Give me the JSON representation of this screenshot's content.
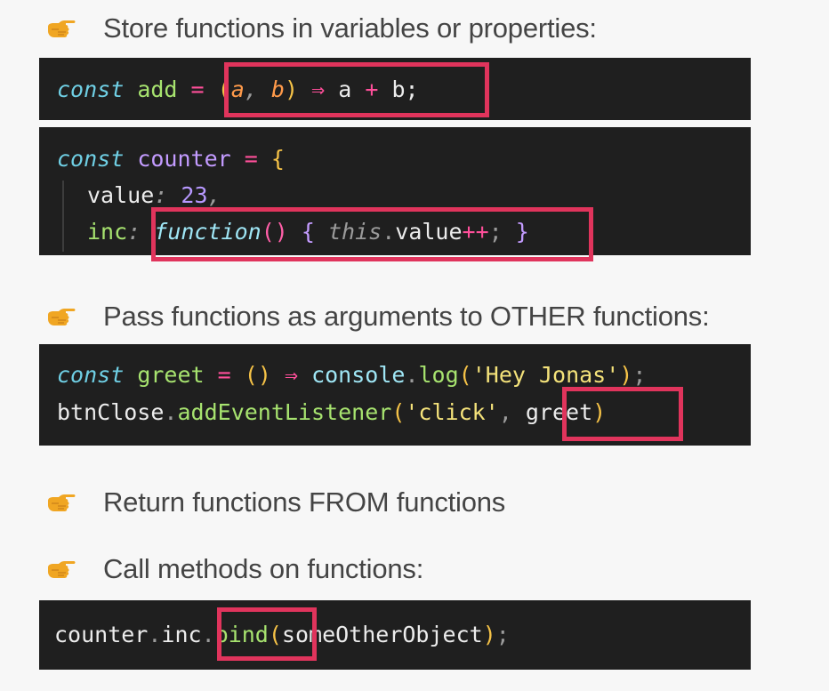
{
  "bullets": [
    "Store functions in variables or properties:",
    "Pass functions as arguments to OTHER functions:",
    "Return functions FROM functions",
    "Call methods on functions:"
  ],
  "code": {
    "add_line": {
      "kw": "const",
      "name": "add",
      "eq": "=",
      "open": "(",
      "a": "a",
      "comma": ",",
      "b": "b",
      "close": ")",
      "arrow": "⇒",
      "body_a": "a",
      "plus": "+",
      "body_b": "b;"
    },
    "counter": {
      "kw": "const",
      "name": "counter",
      "eq": "=",
      "brace": "{",
      "value_key": "value",
      "colon1": ":",
      "value_num": "23",
      "comma1": ",",
      "inc_key": "inc",
      "colon2": ":",
      "fn_kw": "function",
      "parens": "()",
      "open_brace": "{",
      "this_kw": "this",
      "dot": ".",
      "value_ref": "value",
      "incr": "++",
      "semi": ";",
      "close_brace": "}"
    },
    "greet": {
      "kw": "const",
      "name": "greet",
      "eq": "=",
      "parens": "()",
      "arrow": "⇒",
      "console": "console",
      "dot": ".",
      "log": "log",
      "open": "(",
      "str": "'Hey Jonas'",
      "close": ")",
      "semi": ";"
    },
    "listener": {
      "obj": "btnClose",
      "dot": ".",
      "method": "addEventListener",
      "open": "(",
      "str": "'click'",
      "comma": ",",
      "arg": "greet",
      "close": ")"
    },
    "bind": {
      "obj": "counter",
      "dot1": ".",
      "prop": "inc",
      "dot2": ".",
      "method": "bind",
      "open": "(",
      "arg": "someOtherObject",
      "close": ")",
      "semi": ";"
    }
  },
  "colors": {
    "highlight": "#e0345c",
    "code_bg": "#1f1f1f",
    "bullet_icon": "#f0a623"
  },
  "icons": [
    "pointing-hand-icon"
  ]
}
